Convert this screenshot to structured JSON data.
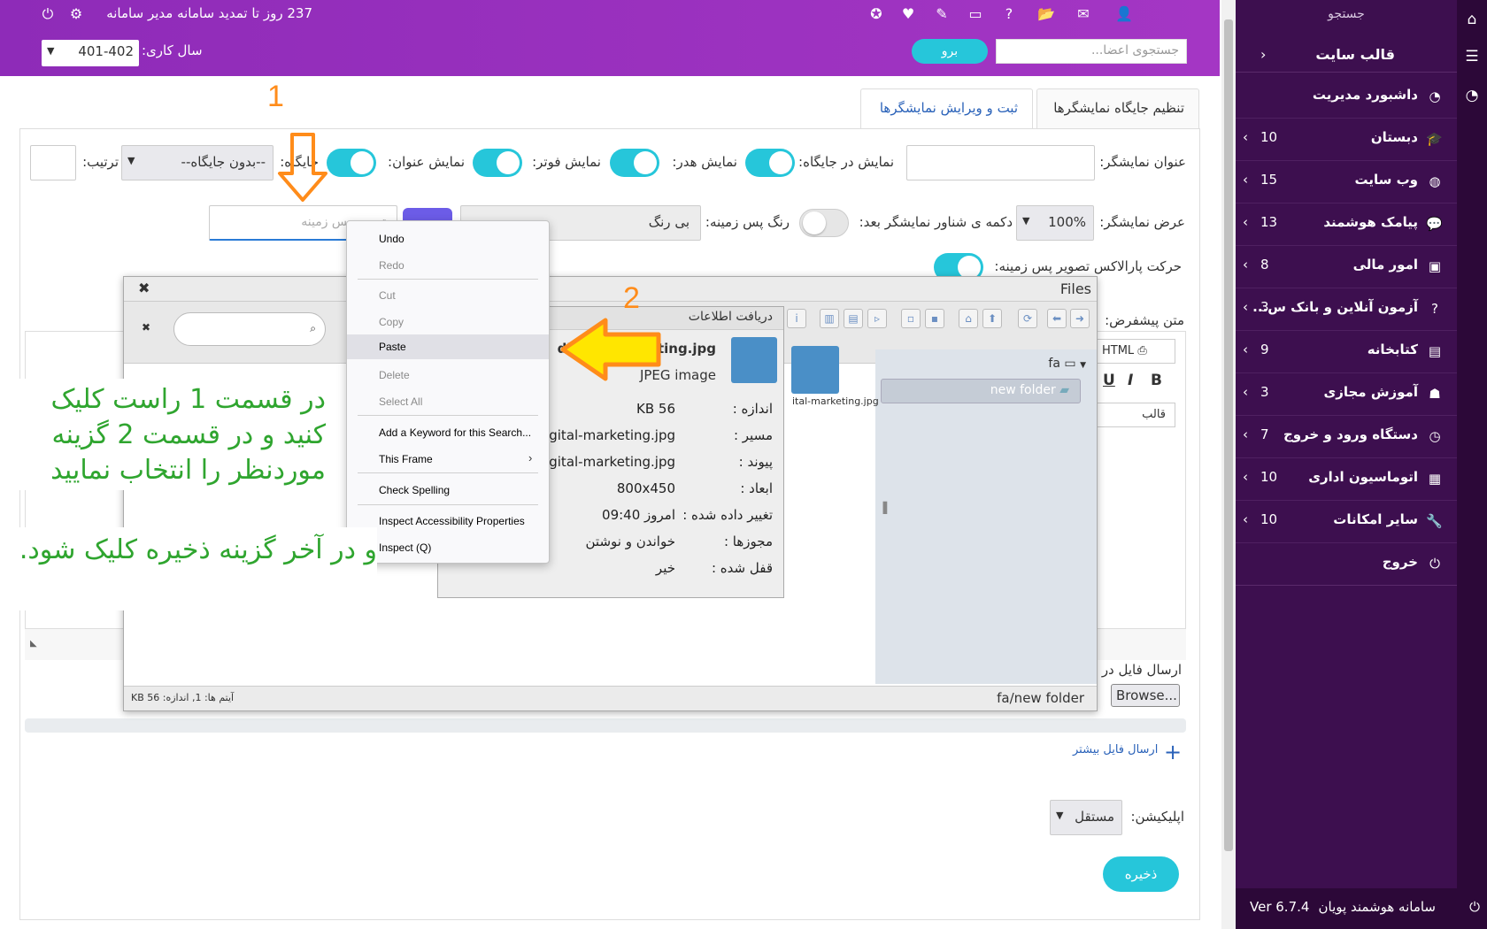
{
  "header": {
    "expire_text": "237 روز تا تمدید سامانه مدیر سامانه",
    "year_label": "سال کاری:",
    "year_value": "401-402",
    "search_placeholder": "جستجوی اعضا...",
    "go_button": "برو",
    "icons": [
      "power-icon",
      "settings-icon",
      "user-plus-icon",
      "mail-icon",
      "folder-icon",
      "help-icon",
      "ticket-icon",
      "edit-icon",
      "heart-pulse-icon",
      "medal-icon"
    ]
  },
  "sidebar": {
    "search_label": "جستجو",
    "template_label": "قالب سایت",
    "items": [
      {
        "label": "داشبورد مدیریت",
        "count": "",
        "icon": "dashboard-icon"
      },
      {
        "label": "دبستان",
        "count": "10",
        "icon": "graduation-cap-icon"
      },
      {
        "label": "وب سایت",
        "count": "15",
        "icon": "globe-icon"
      },
      {
        "label": "پیامک هوشمند",
        "count": "13",
        "icon": "chat-icon"
      },
      {
        "label": "امور مالی",
        "count": "8",
        "icon": "money-icon"
      },
      {
        "label": "آزمون آنلاین و بانک س...",
        "count": "3",
        "icon": "question-icon"
      },
      {
        "label": "کتابخانه",
        "count": "9",
        "icon": "book-icon"
      },
      {
        "label": "آموزش مجازی",
        "count": "3",
        "icon": "reader-icon"
      },
      {
        "label": "دستگاه ورود و خروج",
        "count": "7",
        "icon": "clock-icon"
      },
      {
        "label": "اتوماسیون اداری",
        "count": "10",
        "icon": "automation-icon"
      },
      {
        "label": "سایر امکانات",
        "count": "10",
        "icon": "wrench-icon"
      },
      {
        "label": "خروج",
        "count": "",
        "icon": "logout-icon"
      }
    ],
    "footer_title": "سامانه هوشمند پویان",
    "footer_version": "Ver 6.7.4"
  },
  "tabs": [
    {
      "label": "تنظیم جایگاه نمایشگرها",
      "active": false
    },
    {
      "label": "ثبت و ویرایش نمایشگرها",
      "active": true
    }
  ],
  "form": {
    "title_label": "عنوان نمایشگر:",
    "show_in_place_label": "نمایش در جایگاه:",
    "show_header_label": "نمایش هدر:",
    "show_footer_label": "نمایش فوتر:",
    "show_title_label": "نمایش عنوان:",
    "position_label": "جایگاه:",
    "position_value": "--بدون جایگاه--",
    "order_label": "ترتیب:",
    "width_label": "عرض نمایشگر:",
    "width_value": "100%",
    "float_button_label": "دکمه ی شناور نمایشگر بعد:",
    "bg_color_label": "رنگ پس زمینه:",
    "bg_color_value": "بی رنگ",
    "bg_image_placeholder": "تصویر پس زمینه",
    "parallax_label": "حرکت پارالاکس تصویر پس زمینه:",
    "default_text_label": "متن پیشفرض:",
    "send_file_label": "ارسال فایل در",
    "browse_label": "Browse...",
    "more_files_label": "ارسال فایل بیشتر",
    "application_label": "اپلیکیشن:",
    "application_value": "مستقل",
    "save_button": "ذخیره",
    "editor_html": "HTML",
    "editor_template": "قالب"
  },
  "files_dialog": {
    "title": "Files",
    "tree_root": "fa",
    "tree_folder": "new folder",
    "file_name": "digital-marketing.jpg",
    "file_thumb_label": "ital-marketing.jpg",
    "status_text": "آیتم ها: 1, اندازه: 56 KB",
    "path_text": "fa/new folder",
    "info": {
      "title": "دریافت اطلاعات",
      "name": "digital-marketing.jpg",
      "type": "JPEG image",
      "rows": [
        {
          "key": "اندازه :",
          "value": "56 KB"
        },
        {
          "key": "مسیر :",
          "value": "igital-marketing.jpg"
        },
        {
          "key": "پیوند :",
          "value": "igital-marketing.jpg"
        },
        {
          "key": "ابعاد :",
          "value": "800x450"
        },
        {
          "key": "تغییر داده شده :",
          "value": "امروز 09:40"
        },
        {
          "key": "مجوزها :",
          "value": "خواندن و نوشتن"
        },
        {
          "key": "قفل شده :",
          "value": "خیر"
        }
      ]
    }
  },
  "context_menu": {
    "items": [
      {
        "label": "Undo",
        "disabled": false
      },
      {
        "label": "Redo",
        "disabled": true
      },
      {
        "label": "Cut",
        "disabled": true
      },
      {
        "label": "Copy",
        "disabled": true
      },
      {
        "label": "Paste",
        "disabled": false,
        "highlighted": true
      },
      {
        "label": "Delete",
        "disabled": true
      },
      {
        "label": "Select All",
        "disabled": true
      },
      {
        "label": "Add a Keyword for this Search...",
        "disabled": false
      },
      {
        "label": "This Frame",
        "disabled": false,
        "submenu": true
      },
      {
        "label": "Check Spelling",
        "disabled": false
      },
      {
        "label": "Inspect Accessibility Properties",
        "disabled": false
      },
      {
        "label": "Inspect (Q)",
        "disabled": false
      }
    ]
  },
  "annotations": {
    "marker_1": "1",
    "marker_2": "2",
    "instruction_1": "در قسمت 1 راست کلیک کنید و در قسمت 2 گزینه موردنظر را انتخاب نمایید",
    "instruction_2": "و در آخر گزینه ذخیره کلیک شود.",
    "color": "#2fa52f",
    "arrow_color": "#ff8c1a"
  }
}
